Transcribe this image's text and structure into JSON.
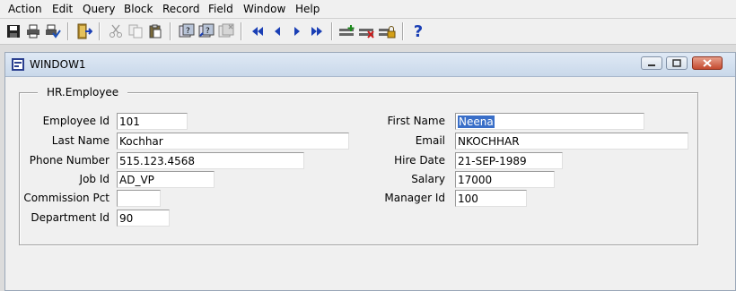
{
  "menu": [
    "Action",
    "Edit",
    "Query",
    "Block",
    "Record",
    "Field",
    "Window",
    "Help"
  ],
  "toolbar": {
    "icons": [
      "save-icon",
      "print-icon",
      "print-setup-icon",
      "exit-icon",
      "cut-icon",
      "copy-icon",
      "paste-icon",
      "enter-query-icon",
      "execute-query-icon",
      "cancel-query-icon",
      "first-record-icon",
      "previous-record-icon",
      "next-record-icon",
      "last-record-icon",
      "insert-record-icon",
      "delete-record-icon",
      "lock-record-icon",
      "help-icon"
    ],
    "help_glyph": "?"
  },
  "window": {
    "title": "WINDOW1"
  },
  "block": {
    "title": "HR.Employee"
  },
  "fields": {
    "employee_id": {
      "label": "Employee Id",
      "value": "101"
    },
    "last_name": {
      "label": "Last Name",
      "value": "Kochhar"
    },
    "phone_number": {
      "label": "Phone Number",
      "value": "515.123.4568"
    },
    "job_id": {
      "label": "Job Id",
      "value": "AD_VP"
    },
    "commission_pct": {
      "label": "Commission Pct",
      "value": ""
    },
    "department_id": {
      "label": "Department Id",
      "value": "90"
    },
    "first_name": {
      "label": "First Name",
      "value": "Neena"
    },
    "email": {
      "label": "Email",
      "value": "NKOCHHAR"
    },
    "hire_date": {
      "label": "Hire Date",
      "value": "21-SEP-1989"
    },
    "salary": {
      "label": "Salary",
      "value": "17000"
    },
    "manager_id": {
      "label": "Manager Id",
      "value": "100"
    }
  },
  "colors": {
    "selection": "#3a6fc8",
    "nav_arrow": "#1a3fb5"
  }
}
